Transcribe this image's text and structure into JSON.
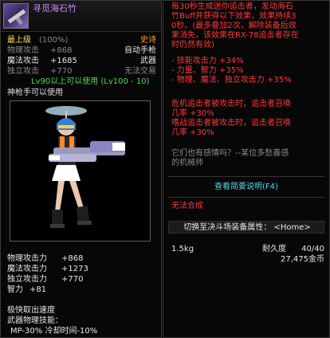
{
  "item": {
    "name": "寻觅海石竹",
    "level": "最上级",
    "level_pct": "(100%)",
    "rarity": "史诗",
    "type_primary": "自动手枪",
    "type_secondary": "武器",
    "untradeable": "无法交易",
    "requirement": "Lv90以上可以使用 (Lv100 - 10)",
    "job": "神枪手可以使用"
  },
  "base_attr": [
    {
      "label": "物理攻击",
      "value": "+868"
    },
    {
      "label": "魔法攻击",
      "value": "+1685"
    },
    {
      "label": "独立攻击",
      "value": "+770"
    }
  ],
  "bonus_stats": [
    {
      "label": "物理攻击力",
      "value": "+868"
    },
    {
      "label": "魔法攻击力",
      "value": "+1273"
    },
    {
      "label": "独立攻击力",
      "value": "+770"
    },
    {
      "label": "智力",
      "value": "+81"
    }
  ],
  "extra": {
    "speed": "极快取出速度",
    "skill_title": "武器物理技能：",
    "skill_line": "MP-30% 冷却时间-10%"
  },
  "effect": {
    "lines": [
      "每30秒生成迷你追击者，发动海石",
      "竹Buff并获得以下效果，效果持续3",
      "0秒。(最多叠加2次，解除装备后效",
      "果消失，该效果在RX-78追击者存在",
      "时仍然有效)"
    ],
    "bullets": [
      "- 技能攻击力 +34%",
      "- 力量、智力 +35%",
      "- 物理、魔法、独立攻击力 +35%"
    ],
    "crisis": [
      "危机追击者被攻击时，追击者召唤",
      "几率 +30%",
      "嗜战追击者被攻击时，追击者召唤",
      "几率 +30%"
    ],
    "flavor": [
      "它们也有感情吗？--某位多愁善感",
      "的机械师"
    ]
  },
  "links": {
    "brief": "查看简要说明(F4)",
    "no_synth": "无法合成",
    "switch_attr": "切换至决斗场装备属性： <Home>"
  },
  "footer": {
    "weight": "1.5kg",
    "durability_label": "耐久度",
    "durability_value": "40/40",
    "price": "27,475金币"
  },
  "colors": {
    "epic": "#c98cff",
    "rarity": "#ff9a2a",
    "requirement": "#4fd94f",
    "stat_value": "#ffe14a",
    "effect_text": "#ff3838",
    "link": "#4fd9e8"
  }
}
